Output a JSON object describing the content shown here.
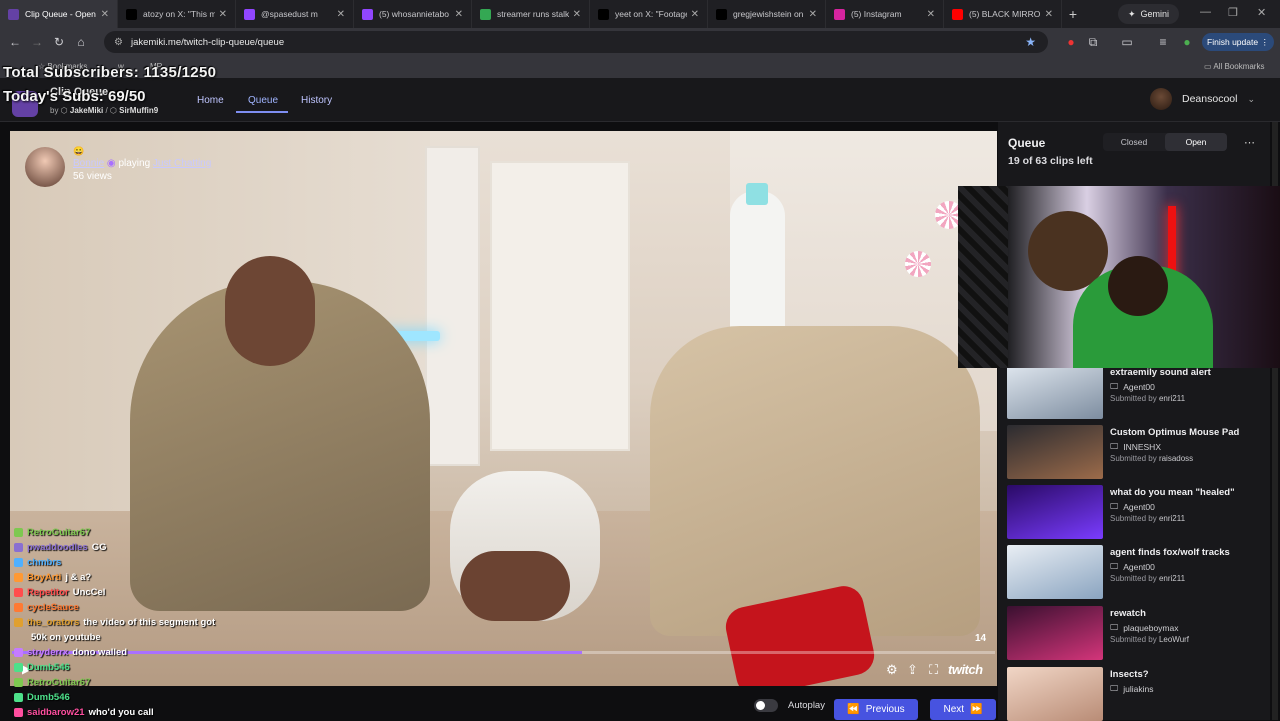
{
  "browser": {
    "tabs": [
      {
        "title": "Clip Queue - Open",
        "color": "#6441a5",
        "icon": "twitch-clip-queue-icon",
        "active": true
      },
      {
        "title": "atozy on X: \"This m",
        "color": "#000000",
        "icon": "x-logo-icon"
      },
      {
        "title": "@spasedust m",
        "color": "#9146ff",
        "icon": "twitch-icon"
      },
      {
        "title": "(5) whosannietabo",
        "color": "#9146ff",
        "icon": "twitch-icon"
      },
      {
        "title": "streamer runs stalk",
        "color": "#34a853",
        "icon": "google-icon"
      },
      {
        "title": "yeet on X: \"Footage",
        "color": "#000000",
        "icon": "x-logo-icon"
      },
      {
        "title": "gregjewishstein on",
        "color": "#000000",
        "icon": "x-logo-icon"
      },
      {
        "title": "(5) Instagram",
        "color": "#d6249f",
        "icon": "instagram-icon"
      },
      {
        "title": "(5) BLACK MIRROR",
        "color": "#ff0000",
        "icon": "youtube-icon"
      }
    ],
    "gemini_label": "Gemini",
    "url": "jakemiki.me/twitch-clip-queue/queue",
    "finish_update": "Finish update",
    "bookmarks": [
      "Bookmarks",
      "w",
      "MR"
    ],
    "all_bookmarks": "All Bookmarks"
  },
  "overlay": {
    "total_subs": "Total Subscribers: 1135/1250",
    "today_subs": "Today's Subs: 69/50"
  },
  "app": {
    "name": "Clip Queue",
    "by": "by",
    "author1": "JakeMiki",
    "author2": "SirMuffin9",
    "nav": {
      "home": "Home",
      "queue": "Queue",
      "history": "History"
    },
    "user": "Deansocool"
  },
  "video": {
    "streamer": "Bonnie",
    "playing": "playing",
    "game": "Just Chatting",
    "views": "56 views",
    "counter": "14",
    "progress": 0.58,
    "brand": "twitch"
  },
  "chat": [
    {
      "user": "RetroGuitar67",
      "color": "#7ec850",
      "msg": ""
    },
    {
      "user": "pwaddoodles",
      "color": "#8a6fd1",
      "msg": "GG"
    },
    {
      "user": "chmbrs",
      "color": "#4fb0ff",
      "msg": ""
    },
    {
      "user": "BoyArti",
      "color": "#ff9933",
      "msg": "j & a?"
    },
    {
      "user": "Repetitor",
      "color": "#ff4d4d",
      "msg": "UncCel"
    },
    {
      "user": "cycleSauce",
      "color": "#ff7a33",
      "msg": ""
    },
    {
      "user": "the_orators",
      "color": "#e0a030",
      "msg": "the video of this segment got"
    },
    {
      "user": "",
      "color": "#ffffff",
      "msg": "50k on youtube"
    },
    {
      "user": "stryderrx",
      "color": "#c57cff",
      "msg": "dono walled"
    },
    {
      "user": "Dumb546",
      "color": "#4de08a",
      "msg": ""
    },
    {
      "user": "RetroGuitar67",
      "color": "#7ec850",
      "msg": ""
    },
    {
      "user": "Dumb546",
      "color": "#4de08a",
      "msg": ""
    },
    {
      "user": "saidbarow21",
      "color": "#ff4fa0",
      "msg": "who'd you call"
    }
  ],
  "queue": {
    "title": "Queue",
    "clips_left": "19 of 63 clips left",
    "closed": "Closed",
    "open": "Open",
    "submitted_by": "Submitted by",
    "clips": [
      {
        "title": "extraemily sound alert",
        "channel": "Agent00",
        "submitter": "enri211",
        "thumb": [
          "#dfe6ee",
          "#7d8da0"
        ]
      },
      {
        "title": "Custom Optimus Mouse Pad",
        "channel": "INNESHX",
        "submitter": "raisadoss",
        "thumb": [
          "#2b2b30",
          "#9c6b4a"
        ]
      },
      {
        "title": "what do you mean \"healed\"",
        "channel": "Agent00",
        "submitter": "enri211",
        "thumb": [
          "#2a0a66",
          "#7a3cff"
        ]
      },
      {
        "title": "agent finds fox/wolf tracks",
        "channel": "Agent00",
        "submitter": "enri211",
        "thumb": [
          "#e9eef4",
          "#8aa4c0"
        ]
      },
      {
        "title": "rewatch",
        "channel": "plaqueboymax",
        "submitter": "LeoWurf",
        "thumb": [
          "#3a1030",
          "#d4357a"
        ]
      },
      {
        "title": "Insects?",
        "channel": "juliakins",
        "submitter": "",
        "thumb": [
          "#f1d6c6",
          "#b98c76"
        ]
      }
    ]
  },
  "controls": {
    "autoplay": "Autoplay",
    "previous": "Previous",
    "next": "Next"
  }
}
